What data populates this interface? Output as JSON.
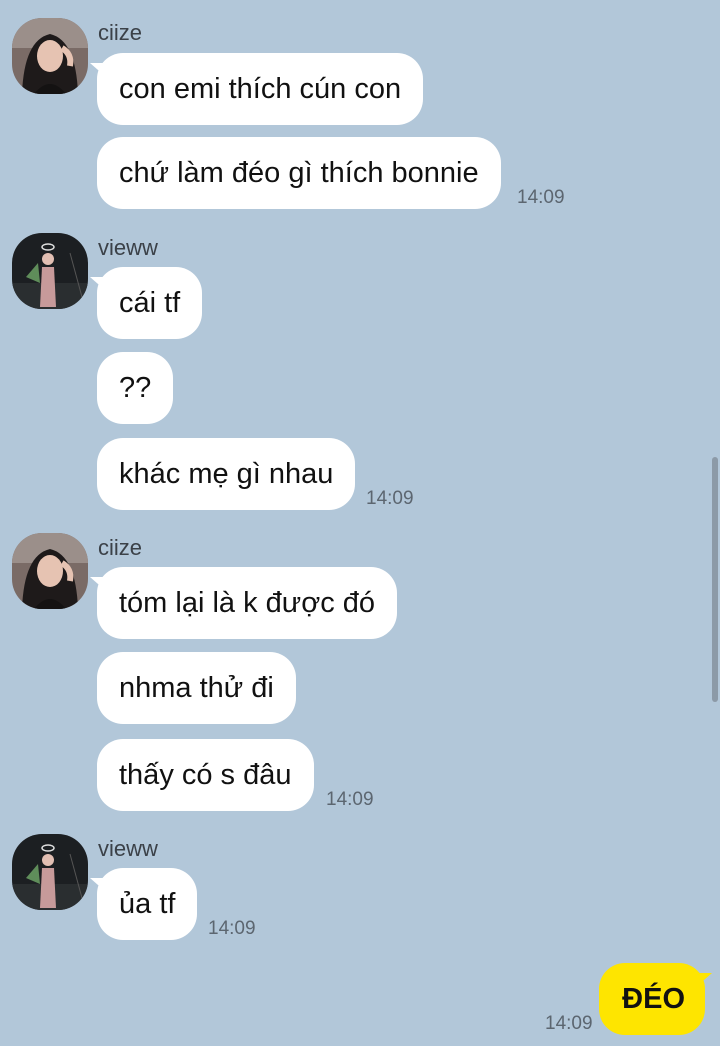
{
  "chat": {
    "groups": [
      {
        "sender": "ciize",
        "avatar_icon": "profile-photo-ciize",
        "messages": [
          "con emi thích cún con",
          "chứ làm đéo gì thích bonnie"
        ],
        "time": "14:09"
      },
      {
        "sender": "vieww",
        "avatar_icon": "profile-photo-vieww",
        "messages": [
          "cái tf",
          "??",
          "khác mẹ gì nhau"
        ],
        "time": "14:09"
      },
      {
        "sender": "ciize",
        "avatar_icon": "profile-photo-ciize",
        "messages": [
          "tóm lại là k được đó",
          "nhma thử đi",
          "thấy có s đâu"
        ],
        "time": "14:09"
      },
      {
        "sender": "vieww",
        "avatar_icon": "profile-photo-vieww",
        "messages": [
          "ủa tf"
        ],
        "time": "14:09"
      }
    ],
    "my_message": {
      "text": "ĐÉO",
      "time": "14:09"
    }
  },
  "colors": {
    "background": "#b2c7d9",
    "incoming_bubble": "#ffffff",
    "outgoing_bubble": "#fee500"
  }
}
